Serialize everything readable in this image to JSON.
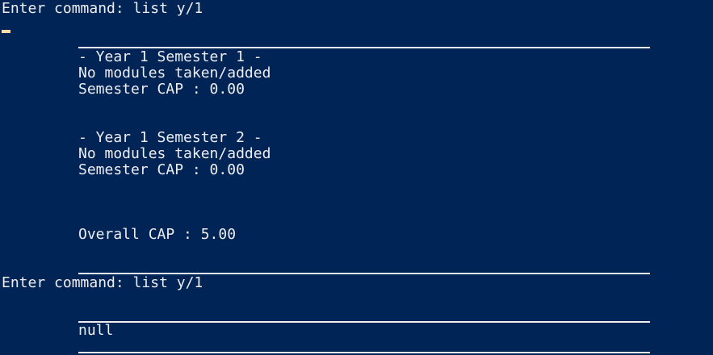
{
  "terminal": {
    "prompt_1": "Enter command: list y/1",
    "sem1_header": "- Year 1 Semester 1 -",
    "sem1_modules": "No modules taken/added",
    "sem1_cap": "Semester CAP : 0.00",
    "sem2_header": "- Year 1 Semester 2 -",
    "sem2_modules": "No modules taken/added",
    "sem2_cap": "Semester CAP : 0.00",
    "overall_cap": "Overall CAP : 5.00",
    "prompt_2": "Enter command: list y/1",
    "output_null": "null"
  },
  "colors": {
    "background": "#012456",
    "text": "#eeedf0",
    "cursor": "#fedba9"
  }
}
